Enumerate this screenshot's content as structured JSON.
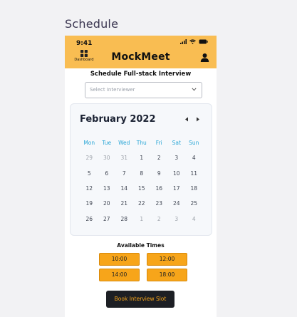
{
  "page": {
    "title": "Schedule"
  },
  "app": {
    "status_time": "9:41",
    "brand": "MockMeet",
    "dashboard_label": "Dashboard",
    "accent_color": "#f9bd52"
  },
  "form": {
    "subtitle": "Schedule Full-stack Interview",
    "select_placeholder": "Select Interviewer"
  },
  "calendar": {
    "month_label": "February 2022",
    "weekdays": [
      "Mon",
      "Tue",
      "Wed",
      "Thu",
      "Fri",
      "Sat",
      "Sun"
    ],
    "weeks": [
      [
        {
          "d": "29",
          "muted": true
        },
        {
          "d": "30",
          "muted": true
        },
        {
          "d": "31",
          "muted": true
        },
        {
          "d": "1"
        },
        {
          "d": "2"
        },
        {
          "d": "3"
        },
        {
          "d": "4"
        }
      ],
      [
        {
          "d": "5"
        },
        {
          "d": "6"
        },
        {
          "d": "7"
        },
        {
          "d": "8"
        },
        {
          "d": "9"
        },
        {
          "d": "10"
        },
        {
          "d": "11"
        }
      ],
      [
        {
          "d": "12"
        },
        {
          "d": "13"
        },
        {
          "d": "14"
        },
        {
          "d": "15"
        },
        {
          "d": "16"
        },
        {
          "d": "17"
        },
        {
          "d": "18"
        }
      ],
      [
        {
          "d": "19"
        },
        {
          "d": "20"
        },
        {
          "d": "21"
        },
        {
          "d": "22"
        },
        {
          "d": "23"
        },
        {
          "d": "24"
        },
        {
          "d": "25"
        }
      ],
      [
        {
          "d": "26"
        },
        {
          "d": "27"
        },
        {
          "d": "28"
        },
        {
          "d": "1",
          "muted": true
        },
        {
          "d": "2",
          "muted": true
        },
        {
          "d": "3",
          "muted": true
        },
        {
          "d": "4",
          "muted": true
        }
      ]
    ]
  },
  "times": {
    "heading": "Available Times",
    "slots": [
      "10:00",
      "12:00",
      "14:00",
      "18:00"
    ]
  },
  "actions": {
    "book_label": "Book Interview Slot"
  }
}
